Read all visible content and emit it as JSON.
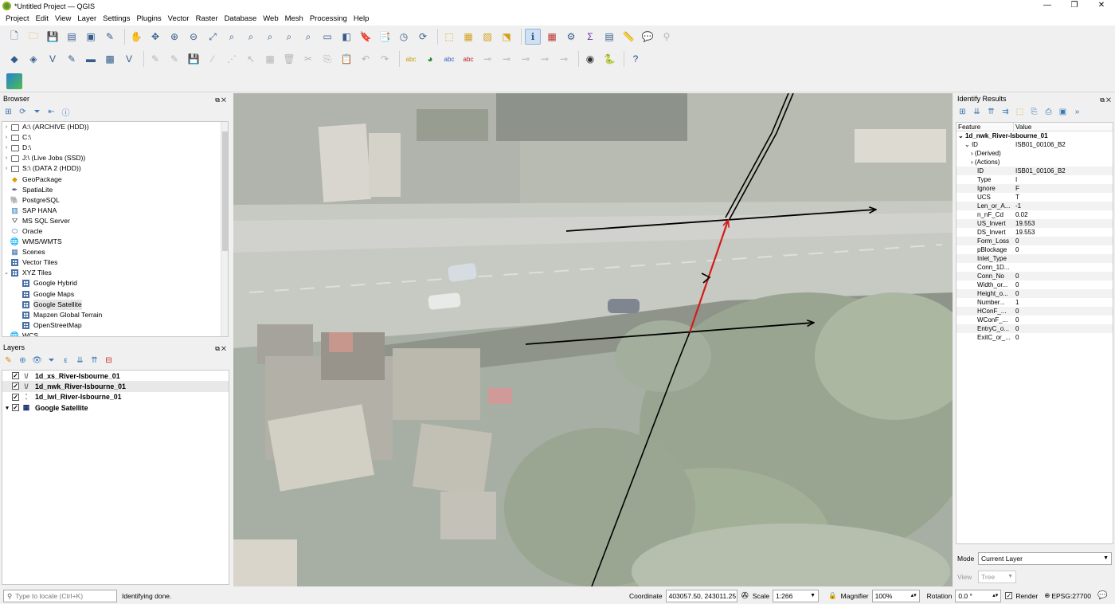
{
  "window": {
    "title": "*Untitled Project — QGIS",
    "minimize": "—",
    "maximize": "❐",
    "close": "✕"
  },
  "menu": [
    "Project",
    "Edit",
    "View",
    "Layer",
    "Settings",
    "Plugins",
    "Vector",
    "Raster",
    "Database",
    "Web",
    "Mesh",
    "Processing",
    "Help"
  ],
  "browser": {
    "title": "Browser",
    "items": [
      {
        "label": "A:\\ (ARCHIVE (HDD))",
        "icon": "folder-icon",
        "expand": "›"
      },
      {
        "label": "C:\\",
        "icon": "folder-icon",
        "expand": "›"
      },
      {
        "label": "D:\\",
        "icon": "folder-icon",
        "expand": "›"
      },
      {
        "label": "J:\\ (Live Jobs (SSD))",
        "icon": "folder-icon",
        "expand": "›"
      },
      {
        "label": "S:\\ (DATA 2 (HDD))",
        "icon": "folder-icon",
        "expand": "›"
      },
      {
        "label": "GeoPackage",
        "icon": "geopackage-icon",
        "expand": ""
      },
      {
        "label": "SpatiaLite",
        "icon": "spatialite-icon",
        "expand": ""
      },
      {
        "label": "PostgreSQL",
        "icon": "postgresql-icon",
        "expand": ""
      },
      {
        "label": "SAP HANA",
        "icon": "saphana-icon",
        "expand": ""
      },
      {
        "label": "MS SQL Server",
        "icon": "mssql-icon",
        "expand": ""
      },
      {
        "label": "Oracle",
        "icon": "oracle-icon",
        "expand": ""
      },
      {
        "label": "WMS/WMTS",
        "icon": "wms-icon",
        "expand": ""
      },
      {
        "label": "Scenes",
        "icon": "scenes-icon",
        "expand": ""
      },
      {
        "label": "Vector Tiles",
        "icon": "vector-tiles-icon",
        "expand": ""
      },
      {
        "label": "XYZ Tiles",
        "icon": "xyz-tiles-icon",
        "expand": "⌄"
      },
      {
        "label": "Google Hybrid",
        "icon": "tile-icon",
        "expand": "",
        "indent": true
      },
      {
        "label": "Google Maps",
        "icon": "tile-icon",
        "expand": "",
        "indent": true
      },
      {
        "label": "Google Satellite",
        "icon": "tile-icon",
        "expand": "",
        "indent": true,
        "selected": true
      },
      {
        "label": "Mapzen Global Terrain",
        "icon": "tile-icon",
        "expand": "",
        "indent": true
      },
      {
        "label": "OpenStreetMap",
        "icon": "tile-icon",
        "expand": "",
        "indent": true
      },
      {
        "label": "WCS",
        "icon": "wcs-icon",
        "expand": ""
      }
    ]
  },
  "layers": {
    "title": "Layers",
    "items": [
      {
        "label": "1d_xs_River-Isbourne_01",
        "icon": "line-layer-icon",
        "checked": "✓",
        "glyph": "\\/"
      },
      {
        "label": "1d_nwk_River-Isbourne_01",
        "icon": "line-layer-icon",
        "checked": "✓",
        "glyph": "\\/",
        "selected": true
      },
      {
        "label": "1d_iwl_River-Isbourne_01",
        "icon": "point-layer-icon",
        "checked": "✓",
        "glyph": "⁚"
      },
      {
        "label": "Google Satellite",
        "icon": "raster-layer-icon",
        "checked": "✓",
        "glyph": "▦",
        "expand": "▾"
      }
    ]
  },
  "identify": {
    "title": "Identify Results",
    "col_feature": "Feature",
    "col_value": "Value",
    "layer_name": "1d_nwk_River-Isbourne_01",
    "id_label": "ID",
    "id_value": "ISB01_00106_B2",
    "derived": "(Derived)",
    "actions": "(Actions)",
    "attributes": [
      {
        "name": "ID",
        "value": "ISB01_00106_B2"
      },
      {
        "name": "Type",
        "value": "I"
      },
      {
        "name": "Ignore",
        "value": "F"
      },
      {
        "name": "UCS",
        "value": "T"
      },
      {
        "name": "Len_or_A...",
        "value": "-1"
      },
      {
        "name": "n_nF_Cd",
        "value": "0.02"
      },
      {
        "name": "US_Invert",
        "value": "19.553"
      },
      {
        "name": "DS_Invert",
        "value": "19.553"
      },
      {
        "name": "Form_Loss",
        "value": "0"
      },
      {
        "name": "pBlockage",
        "value": "0"
      },
      {
        "name": "Inlet_Type",
        "value": ""
      },
      {
        "name": "Conn_1D...",
        "value": ""
      },
      {
        "name": "Conn_No",
        "value": "0"
      },
      {
        "name": "Width_or...",
        "value": "0"
      },
      {
        "name": "Height_o...",
        "value": "0"
      },
      {
        "name": "Number...",
        "value": "1"
      },
      {
        "name": "HConF_...",
        "value": "0"
      },
      {
        "name": "WConF_...",
        "value": "0"
      },
      {
        "name": "EntryC_o...",
        "value": "0"
      },
      {
        "name": "ExitC_or_...",
        "value": "0"
      }
    ],
    "mode_label": "Mode",
    "mode_value": "Current Layer",
    "view_label": "View",
    "view_value": "Tree"
  },
  "status": {
    "locator_placeholder": "Type to locate (Ctrl+K)",
    "message": "Identifying done.",
    "coordinate_label": "Coordinate",
    "coordinate_value": "403057.50, 243011.25",
    "scale_label": "Scale",
    "scale_value": "1:266",
    "magnifier_label": "Magnifier",
    "magnifier_value": "100%",
    "rotation_label": "Rotation",
    "rotation_value": "0.0 °",
    "render_label": "Render",
    "crs": "EPSG:27700"
  }
}
